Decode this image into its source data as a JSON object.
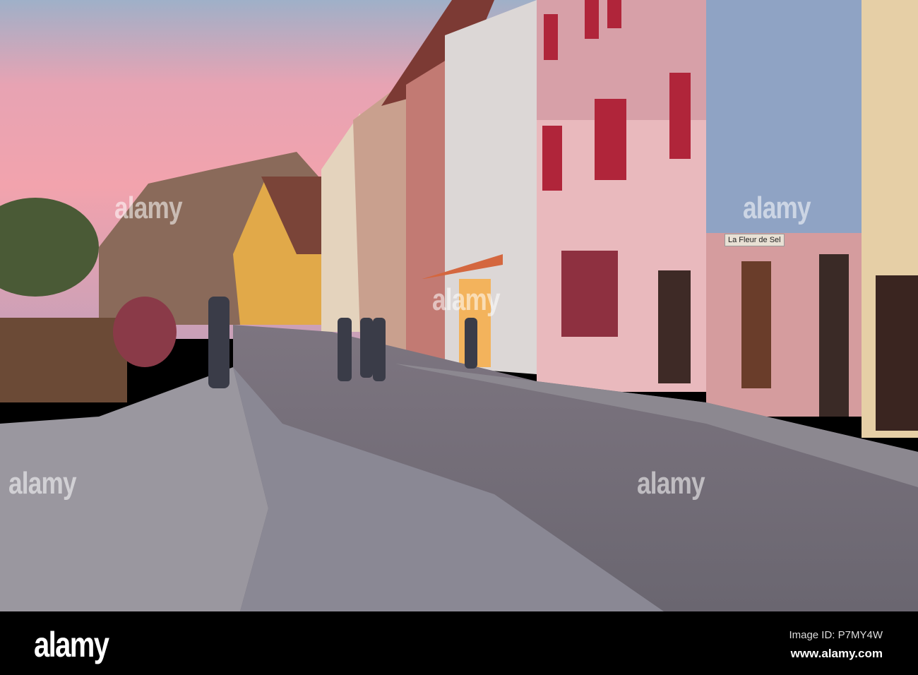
{
  "photo": {
    "shop_sign": "La Fleur de Sel",
    "watermark": "alamy"
  },
  "footer": {
    "logo": "alamy",
    "image_id": "Image ID: P7MY4W",
    "website": "www.alamy.com"
  },
  "colors": {
    "sky_top": "#9fb0c8",
    "sky_pink": "#f2a3ad",
    "cobble": "#6e6a70",
    "pink_house": "#e9b9bd",
    "blue_house": "#8fa3c4",
    "shutter_red": "#b0253a"
  }
}
